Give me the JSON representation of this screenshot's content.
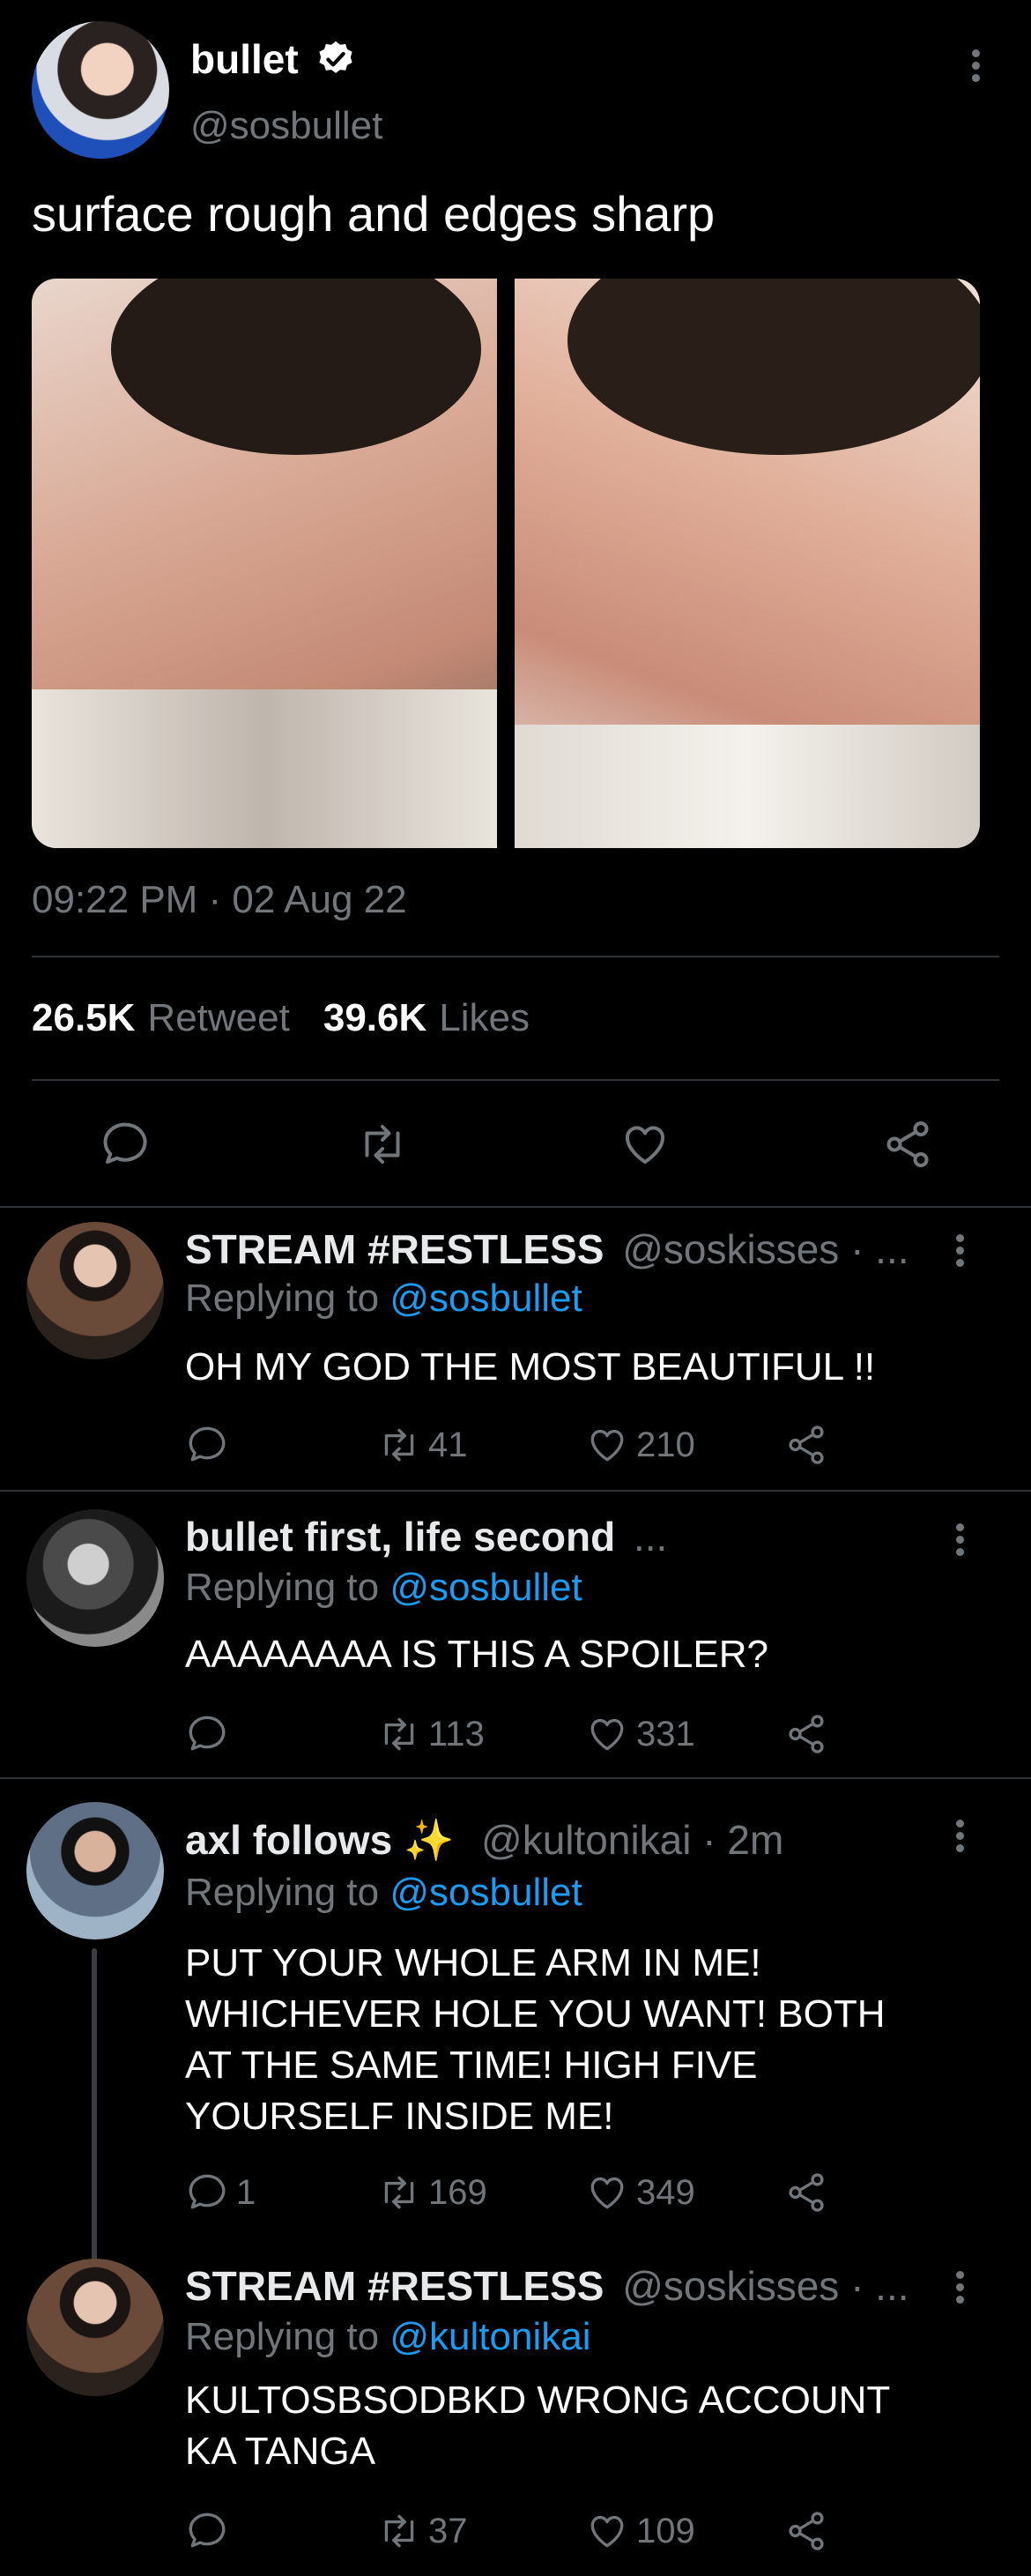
{
  "tweet": {
    "display_name": "bullet",
    "handle": "@sosbullet",
    "text": "surface rough and edges sharp",
    "timestamp": "09:22 PM · 02 Aug 22",
    "retweets_count": "26.5K",
    "retweets_label": "Retweet",
    "likes_count": "39.6K",
    "likes_label": "Likes"
  },
  "replies": [
    {
      "name": "STREAM #RESTLESS",
      "handle": "@soskisses · ...",
      "replying_prefix": "Replying to",
      "replying_to": "@sosbullet",
      "lines": [
        "OH MY GOD THE MOST BEAUTIFUL !!"
      ],
      "reply_count": "",
      "retweet_count": "41",
      "like_count": "210"
    },
    {
      "name": "bullet first, life second",
      "handle": "...",
      "replying_prefix": "Replying to",
      "replying_to": "@sosbullet",
      "lines": [
        "AAAAAAAA IS THIS A SPOILER?"
      ],
      "reply_count": "",
      "retweet_count": "113",
      "like_count": "331"
    },
    {
      "name": "axl follows ✨",
      "handle": "@kultonikai · 2m",
      "replying_prefix": "Replying to",
      "replying_to": "@sosbullet",
      "lines": [
        "PUT YOUR WHOLE ARM IN ME!",
        "WHICHEVER HOLE YOU WANT! BOTH",
        "AT THE SAME TIME! HIGH FIVE",
        "YOURSELF INSIDE ME!"
      ],
      "reply_count": "1",
      "retweet_count": "169",
      "like_count": "349"
    },
    {
      "name": "STREAM #RESTLESS",
      "handle": "@soskisses · ...",
      "replying_prefix": "Replying to",
      "replying_to": "@kultonikai",
      "lines": [
        "KULTOSBSODBKD WRONG ACCOUNT",
        "KA TANGA"
      ],
      "reply_count": "",
      "retweet_count": "37",
      "like_count": "109"
    }
  ],
  "colors": {
    "background": "#000000",
    "text": "#e7e9ea",
    "muted": "#71767b",
    "link": "#1d9bf0",
    "divider": "#2f3336"
  },
  "icons": [
    "verified-badge-icon",
    "more-dots-icon",
    "reply-icon",
    "retweet-icon",
    "like-icon",
    "share-icon"
  ]
}
